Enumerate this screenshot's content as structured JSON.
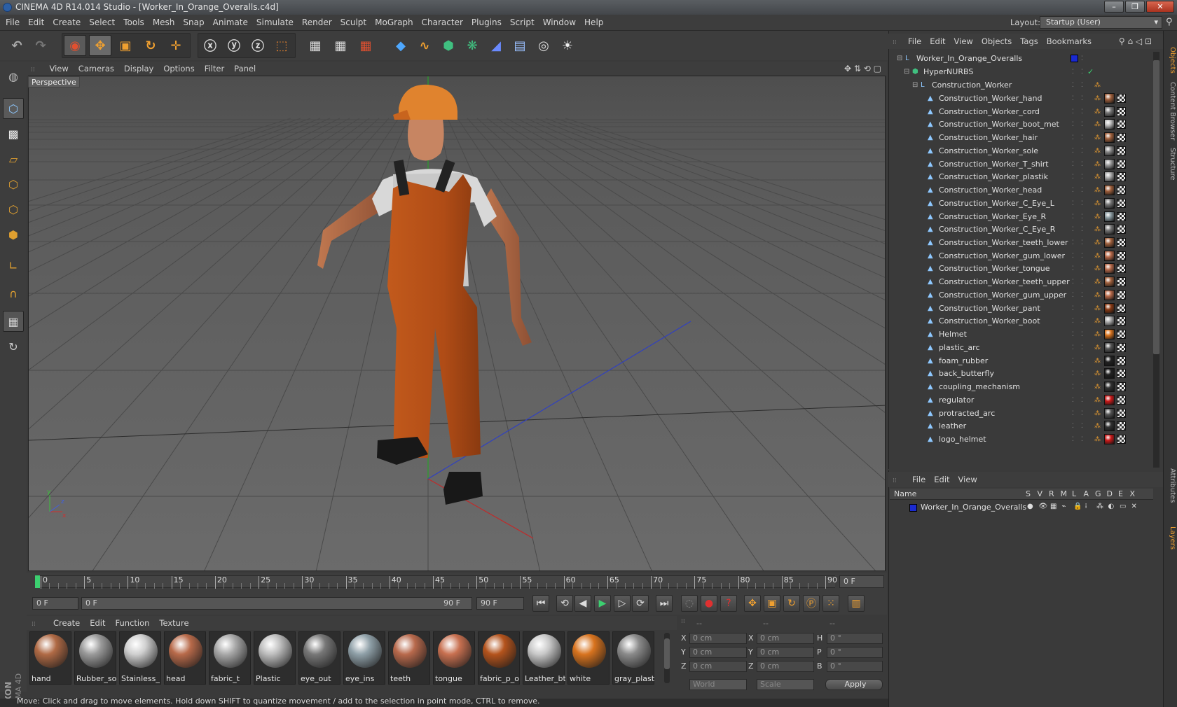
{
  "window": {
    "title": "CINEMA 4D R14.014 Studio - [Worker_In_Orange_Overalls.c4d]"
  },
  "menubar": {
    "items": [
      "File",
      "Edit",
      "Create",
      "Select",
      "Tools",
      "Mesh",
      "Snap",
      "Animate",
      "Simulate",
      "Render",
      "Sculpt",
      "MoGraph",
      "Character",
      "Plugins",
      "Script",
      "Window",
      "Help"
    ],
    "layout_label": "Layout:",
    "layout_value": "Startup (User)"
  },
  "viewport": {
    "menu": [
      "View",
      "Cameras",
      "Display",
      "Options",
      "Filter",
      "Panel"
    ],
    "label": "Perspective",
    "axis": {
      "x": "x",
      "y": "y",
      "z": "z"
    }
  },
  "timeline": {
    "ticks": [
      "0",
      "5",
      "10",
      "15",
      "20",
      "25",
      "30",
      "35",
      "40",
      "45",
      "50",
      "55",
      "60",
      "65",
      "70",
      "75",
      "80",
      "85",
      "90"
    ],
    "current_frame": "0 F",
    "start_frame": "0 F",
    "slider_start": "0 F",
    "slider_end": "90 F",
    "end_frame": "90 F"
  },
  "materials": {
    "menu": [
      "Create",
      "Edit",
      "Function",
      "Texture"
    ],
    "items": [
      {
        "label": "hand",
        "color": "#b06a45"
      },
      {
        "label": "Rubber_so",
        "color": "#9a9a9a"
      },
      {
        "label": "Stainless_",
        "color": "#cfcfcf"
      },
      {
        "label": "head",
        "color": "#b86a4a"
      },
      {
        "label": "fabric_t",
        "color": "#a8a8a8"
      },
      {
        "label": "Plastic",
        "color": "#bdbdbd"
      },
      {
        "label": "eye_out",
        "color": "#777777"
      },
      {
        "label": "eye_ins",
        "color": "#8fa0a8"
      },
      {
        "label": "teeth",
        "color": "#b8694c"
      },
      {
        "label": "tongue",
        "color": "#c87050"
      },
      {
        "label": "fabric_p_o",
        "color": "#b4531c"
      },
      {
        "label": "Leather_bt",
        "color": "#c8c8c8"
      },
      {
        "label": "white",
        "color": "#d8731e"
      },
      {
        "label": "gray_plasti",
        "color": "#8a8a8a"
      }
    ]
  },
  "coords": {
    "headers": [
      "--",
      "--",
      "--"
    ],
    "rows": [
      {
        "a": "X",
        "av": "0 cm",
        "b": "X",
        "bv": "0 cm",
        "c": "H",
        "cv": "0 °"
      },
      {
        "a": "Y",
        "av": "0 cm",
        "b": "Y",
        "bv": "0 cm",
        "c": "P",
        "cv": "0 °"
      },
      {
        "a": "Z",
        "av": "0 cm",
        "b": "Z",
        "bv": "0 cm",
        "c": "B",
        "cv": "0 °"
      }
    ],
    "space": "World",
    "mode": "Scale",
    "apply": "Apply"
  },
  "status": "Move: Click and drag to move elements. Hold down SHIFT to quantize movement / add to the selection in point mode, CTRL to remove.",
  "objects": {
    "menu": [
      "File",
      "Edit",
      "View",
      "Objects",
      "Tags",
      "Bookmarks"
    ],
    "root": "Worker_In_Orange_Overalls",
    "hypernurbs": "HyperNURBS",
    "group": "Construction_Worker",
    "items": [
      {
        "name": "Construction_Worker_hand",
        "tag": "#a0603c"
      },
      {
        "name": "Construction_Worker_cord",
        "tag": "#777777"
      },
      {
        "name": "Construction_Worker_boot_met",
        "tag": "#bbbbbb"
      },
      {
        "name": "Construction_Worker_hair",
        "tag": "#a0603c"
      },
      {
        "name": "Construction_Worker_sole",
        "tag": "#888888"
      },
      {
        "name": "Construction_Worker_T_shirt",
        "tag": "#999999"
      },
      {
        "name": "Construction_Worker_plastik",
        "tag": "#aaaaaa"
      },
      {
        "name": "Construction_Worker_head",
        "tag": "#a0603c"
      },
      {
        "name": "Construction_Worker_C_Eye_L",
        "tag": "#777777"
      },
      {
        "name": "Construction_Worker_Eye_R",
        "tag": "#8a9aa0"
      },
      {
        "name": "Construction_Worker_C_Eye_R",
        "tag": "#777777"
      },
      {
        "name": "Construction_Worker_teeth_lower",
        "tag": "#a0603c"
      },
      {
        "name": "Construction_Worker_gum_lower",
        "tag": "#b86a4a"
      },
      {
        "name": "Construction_Worker_tongue",
        "tag": "#b86a4a"
      },
      {
        "name": "Construction_Worker_teeth_upper",
        "tag": "#a0603c"
      },
      {
        "name": "Construction_Worker_gum_upper",
        "tag": "#b86a4a"
      },
      {
        "name": "Construction_Worker_pant",
        "tag": "#8a3a14"
      },
      {
        "name": "Construction_Worker_boot",
        "tag": "#aaaaaa"
      },
      {
        "name": "Helmet",
        "tag": "#d8731e"
      },
      {
        "name": "plastic_arc",
        "tag": "#555555"
      },
      {
        "name": "foam_rubber",
        "tag": "#222222"
      },
      {
        "name": "back_butterfly",
        "tag": "#222222"
      },
      {
        "name": "coupling_mechanism",
        "tag": "#333333"
      },
      {
        "name": "regulator",
        "tag": "#cc1a1a"
      },
      {
        "name": "protracted_arc",
        "tag": "#555555"
      },
      {
        "name": "leather",
        "tag": "#333333"
      },
      {
        "name": "logo_helmet",
        "tag": "#cc1a1a"
      }
    ]
  },
  "layers": {
    "menu": [
      "File",
      "Edit",
      "View"
    ],
    "name_header": "Name",
    "columns": [
      "S",
      "V",
      "R",
      "M",
      "L",
      "A",
      "G",
      "D",
      "E",
      "X"
    ],
    "rows": [
      {
        "name": "Worker_In_Orange_Overalls",
        "color": "#1a2ad0"
      }
    ]
  },
  "sidetabs": [
    "Objects",
    "Content Browser",
    "Structure",
    "Attributes",
    "Layers"
  ],
  "brand": {
    "line1": "MAXON",
    "line2": "CINEMA 4D"
  },
  "colors": {
    "accent": "#f0a030",
    "layer_blue": "#1a2ad0"
  }
}
